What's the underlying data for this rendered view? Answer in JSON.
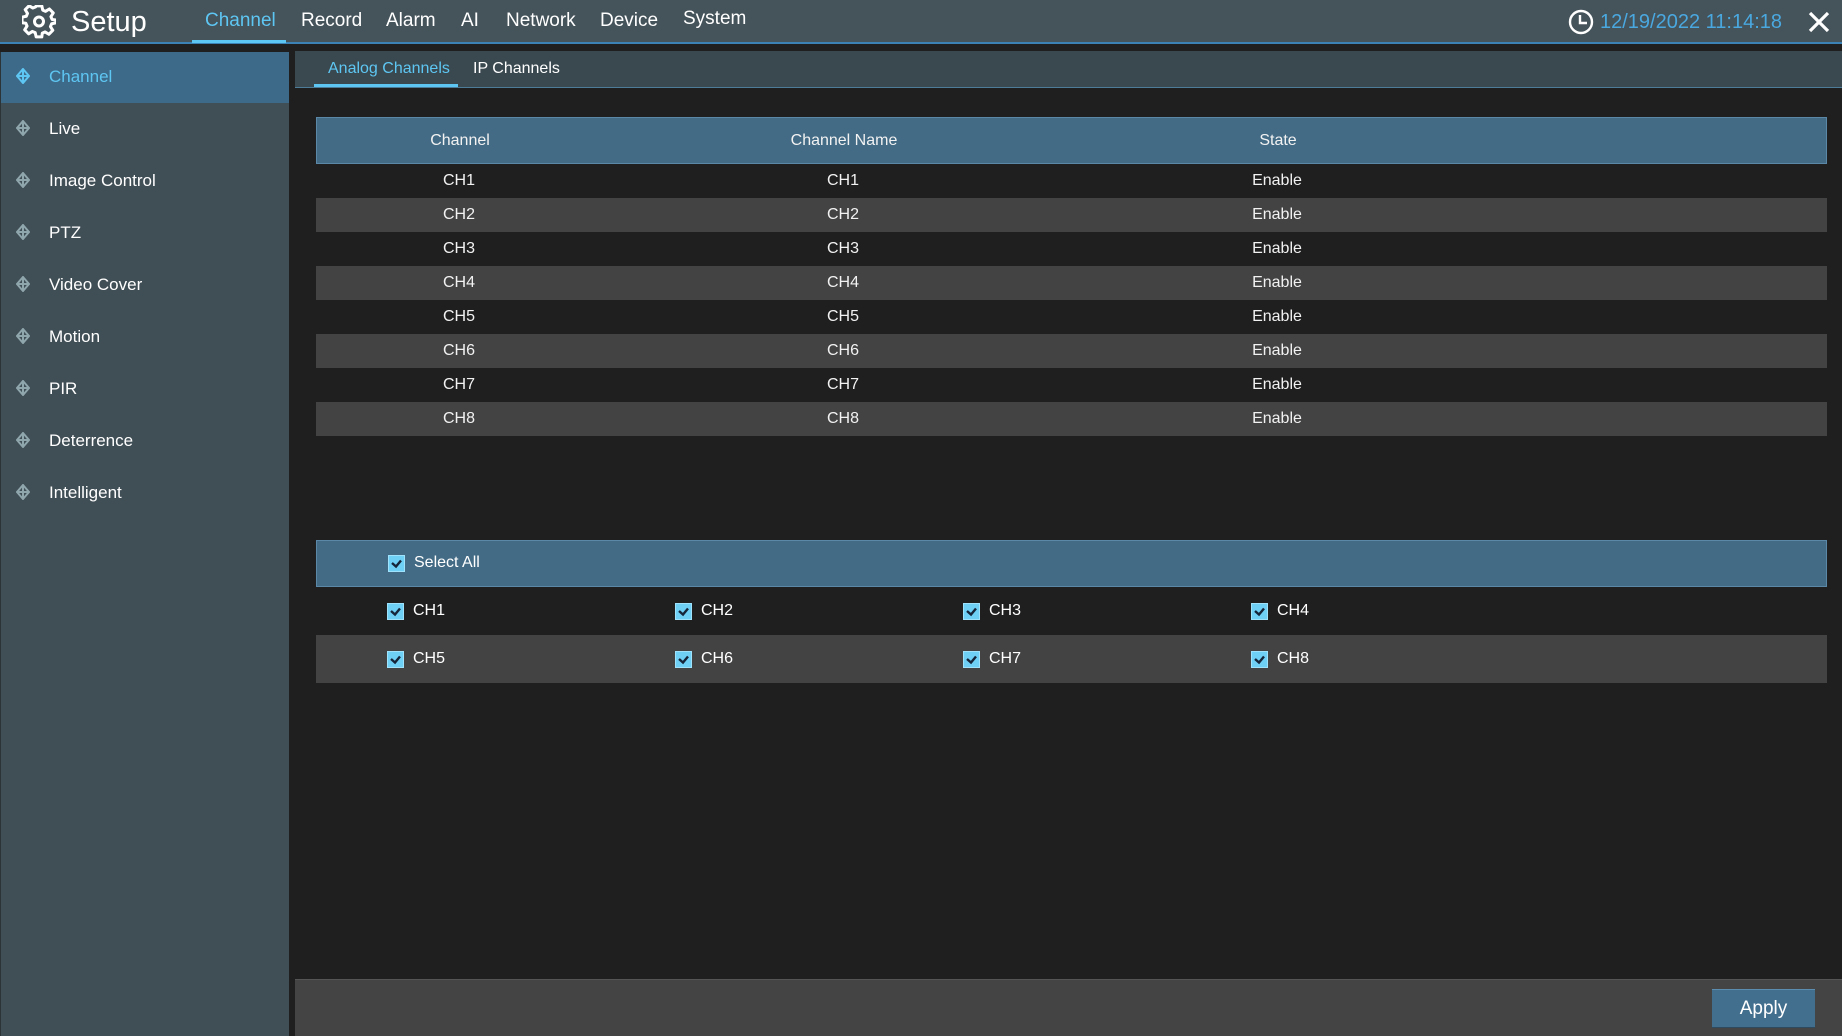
{
  "header": {
    "title": "Setup",
    "icon": "gear-icon",
    "nav": [
      {
        "label": "Channel",
        "active": true
      },
      {
        "label": "Record"
      },
      {
        "label": "Alarm"
      },
      {
        "label": "AI"
      },
      {
        "label": "Network"
      },
      {
        "label": "Device"
      },
      {
        "label": "System"
      }
    ],
    "datetime": "12/19/2022 11:14:18",
    "clock_icon": "clock-icon",
    "close_icon": "close-icon"
  },
  "sidebar": {
    "items": [
      {
        "label": "Channel",
        "active": true
      },
      {
        "label": "Live"
      },
      {
        "label": "Image Control"
      },
      {
        "label": "PTZ"
      },
      {
        "label": "Video Cover"
      },
      {
        "label": "Motion"
      },
      {
        "label": "PIR"
      },
      {
        "label": "Deterrence"
      },
      {
        "label": "Intelligent"
      }
    ]
  },
  "subtabs": [
    {
      "label": "Analog Channels",
      "active": true
    },
    {
      "label": "IP Channels"
    }
  ],
  "table": {
    "columns": [
      "Channel",
      "Channel Name",
      "State"
    ],
    "rows": [
      [
        "CH1",
        "CH1",
        "Enable"
      ],
      [
        "CH2",
        "CH2",
        "Enable"
      ],
      [
        "CH3",
        "CH3",
        "Enable"
      ],
      [
        "CH4",
        "CH4",
        "Enable"
      ],
      [
        "CH5",
        "CH5",
        "Enable"
      ],
      [
        "CH6",
        "CH6",
        "Enable"
      ],
      [
        "CH7",
        "CH7",
        "Enable"
      ],
      [
        "CH8",
        "CH8",
        "Enable"
      ]
    ]
  },
  "selection": {
    "select_all": {
      "label": "Select All",
      "checked": true
    },
    "channels": [
      {
        "label": "CH1",
        "checked": true
      },
      {
        "label": "CH2",
        "checked": true
      },
      {
        "label": "CH3",
        "checked": true
      },
      {
        "label": "CH4",
        "checked": true
      },
      {
        "label": "CH5",
        "checked": true
      },
      {
        "label": "CH6",
        "checked": true
      },
      {
        "label": "CH7",
        "checked": true
      },
      {
        "label": "CH8",
        "checked": true
      }
    ]
  },
  "footer": {
    "apply_label": "Apply"
  },
  "colors": {
    "accent": "#5ec6f2",
    "datetime": "#4aa8e0",
    "header_blue": "#436b85"
  }
}
